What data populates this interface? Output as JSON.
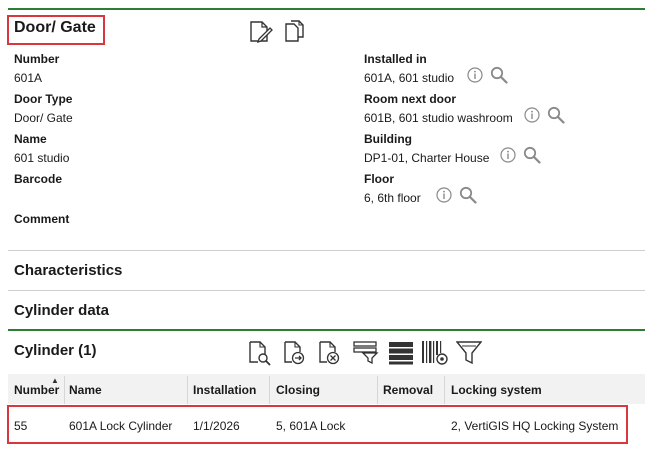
{
  "header": {
    "title": "Door/ Gate",
    "icons": [
      "edit-document-icon",
      "copy-document-icon"
    ]
  },
  "fields_left": [
    {
      "label": "Number",
      "value": "601A"
    },
    {
      "label": "Door Type",
      "value": "Door/ Gate"
    },
    {
      "label": "Name",
      "value": "601 studio"
    },
    {
      "label": "Barcode",
      "value": ""
    },
    {
      "label": "Comment",
      "value": ""
    }
  ],
  "fields_right": [
    {
      "label": "Installed in",
      "value": "601A, 601 studio"
    },
    {
      "label": "Room next door",
      "value": "601B, 601 studio washroom"
    },
    {
      "label": "Building",
      "value": "DP1-01, Charter House"
    },
    {
      "label": "Floor",
      "value": "6, 6th floor"
    }
  ],
  "sections": {
    "characteristics": "Characteristics",
    "cylinder_data": "Cylinder data",
    "cylinder": "Cylinder (1)"
  },
  "cylinder_toolbar": [
    "view-document-icon",
    "export-document-icon",
    "remove-document-icon",
    "filter-rows-icon",
    "list-view-icon",
    "barcode-settings-icon",
    "funnel-filter-icon"
  ],
  "table": {
    "sort_indicator": "▲",
    "columns": [
      "Number",
      "Name",
      "Installation",
      "Closing",
      "Removal",
      "Locking system"
    ],
    "rows": [
      [
        "55",
        "601A Lock Cylinder",
        "1/1/2026",
        "5, 601A Lock",
        "",
        "2, VertiGIS HQ Locking System"
      ]
    ]
  },
  "colors": {
    "accent_green": "#2e7d32",
    "highlight_red": "#d9363e",
    "icon_gray": "#8a8a8a"
  }
}
